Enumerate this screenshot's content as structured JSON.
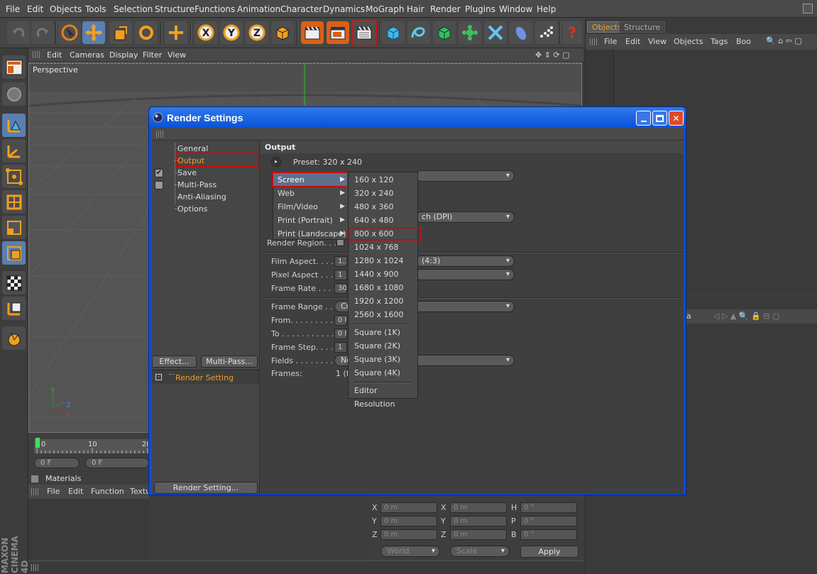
{
  "menubar": [
    "File",
    "Edit",
    "Objects",
    "Tools",
    "Selection",
    "Structure",
    "Functions",
    "Animation",
    "Character",
    "Dynamics",
    "MoGraph",
    "Hair",
    "Render",
    "Plugins",
    "Window",
    "Help"
  ],
  "toolbar": {
    "x_axis": "X",
    "y_axis": "Y",
    "z_axis": "Z"
  },
  "viewport": {
    "menu": [
      "Edit",
      "Cameras",
      "Display",
      "Filter",
      "View"
    ],
    "label": "Perspective",
    "axis_x": "X",
    "axis_y": "Y",
    "axis_z": "Z"
  },
  "timeline": {
    "ticks": [
      "0",
      "10",
      "20"
    ],
    "current_frame": "0 F",
    "frame_field": "0 F"
  },
  "materials": {
    "title": "Materials",
    "menu": [
      "File",
      "Edit",
      "Function",
      "Textu"
    ]
  },
  "objects_panel": {
    "tabs": [
      "Objects",
      "Structure"
    ],
    "menu": [
      "File",
      "Edit",
      "View",
      "Objects",
      "Tags",
      "Boo"
    ]
  },
  "attributes_panel": {
    "partial_label": "a"
  },
  "coordinates": {
    "rows": [
      {
        "a": "X",
        "av": "0 m",
        "b": "X",
        "bv": "0 m",
        "c": "H",
        "cv": "0 °"
      },
      {
        "a": "Y",
        "av": "0 m",
        "b": "Y",
        "bv": "0 m",
        "c": "P",
        "cv": "0 °"
      },
      {
        "a": "Z",
        "av": "0 m",
        "b": "Z",
        "bv": "0 m",
        "c": "B",
        "cv": "0 °"
      }
    ],
    "world": "World",
    "scale": "Scale",
    "apply": "Apply"
  },
  "branding": "MAXON CINEMA 4D",
  "dialog": {
    "title": "Render Settings",
    "nav": [
      "General",
      "Output",
      "Save",
      "Multi-Pass",
      "Anti-Aliasing",
      "Options"
    ],
    "save_checked": "✔",
    "effect_button": "Effect...",
    "multipass_button": "Multi-Pass...",
    "render_setting_item": "Render Setting",
    "render_setting_button": "Render Setting...",
    "section": "Output",
    "preset": "Preset: 320 x 240",
    "dpi_partial": "ch (DPI)",
    "render_region": "Render Region. . .",
    "film_aspect_label": "Film Aspect. . . . . .",
    "film_aspect_value": "1.3",
    "film_aspect_dd": "(4:3)",
    "pixel_aspect_label": "Pixel Aspect . . . .",
    "pixel_aspect_value": "1",
    "frame_rate_label": "Frame Rate . . . . .",
    "frame_rate_value": "30",
    "frame_range_label": "Frame Range . . . .",
    "frame_range_value": "Cu",
    "from_label": "From. . . . . . . . . .",
    "from_value": "0 F",
    "to_label": "To . . . . . . . . . . .",
    "to_value": "0 F",
    "frame_step_label": "Frame Step. . . . .",
    "frame_step_value": "1",
    "fields_label": "Fields . . . . . . . . .",
    "fields_value": "No",
    "frames_label": "Frames:",
    "frames_value": "1 (fr"
  },
  "preset_menu": {
    "categories": [
      "Screen",
      "Web",
      "Film/Video",
      "Print (Portrait)",
      "Print (Landscape)"
    ],
    "resolutions": [
      "160 x 120",
      "320 x 240",
      "480 x 360",
      "640 x 480",
      "800 x 600",
      "1024 x 768",
      "1280 x 1024",
      "1440 x 900",
      "1680 x 1080",
      "1920 x 1200",
      "2560 x 1600"
    ],
    "squares": [
      "Square (1K)",
      "Square (2K)",
      "Square (3K)",
      "Square (4K)"
    ],
    "editor": "Editor Resolution"
  }
}
